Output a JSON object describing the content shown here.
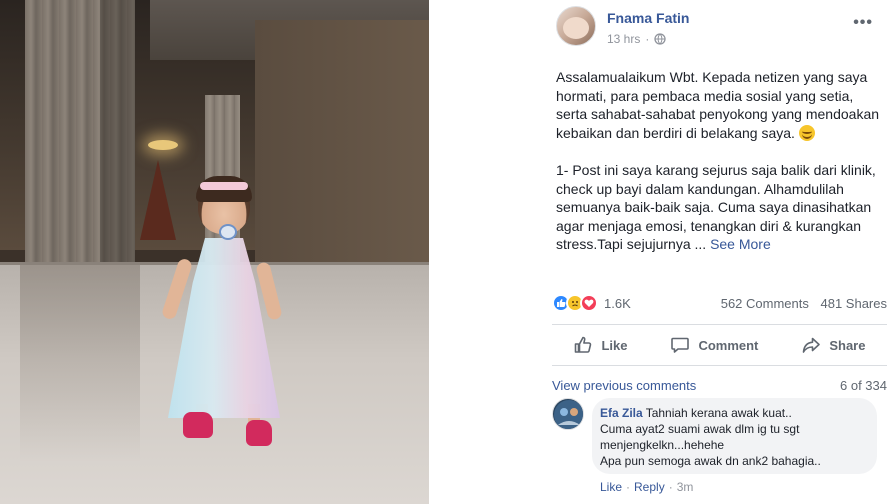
{
  "post": {
    "author": "Fnama Fatin",
    "time": "13 hrs",
    "privacy_icon": "globe-icon",
    "paragraph1": "Assalamualaikum Wbt. Kepada netizen yang saya hormati, para pembaca media sosial yang setia, serta sahabat-sahabat penyokong yang mendoakan kebaikan dan berdiri di belakang saya.",
    "paragraph2": "1- Post ini saya karang sejurus saja balik dari klinik, check up bayi dalam kandungan. Alhamdulilah semuanya baik-baik saja. Cuma saya dinasihatkan agar menjaga emosi, tenangkan diri & kurangkan stress.Tapi sejujurnya ...",
    "see_more": "See More",
    "more_icon": "•••"
  },
  "stats": {
    "reactions_count": "1.6K",
    "reaction_icons": [
      "like-reaction-icon",
      "sad-reaction-icon",
      "love-reaction-icon"
    ],
    "comments": "562 Comments",
    "shares": "481 Shares"
  },
  "actions": {
    "like": "Like",
    "comment": "Comment",
    "share": "Share"
  },
  "comments_section": {
    "view_previous": "View previous comments",
    "count": "6 of 334",
    "comment": {
      "author": "Efa Zila",
      "line1": "Tahniah kerana awak kuat..",
      "line2": "Cuma ayat2 suami awak dlm ig tu sgt",
      "line3": "menjengkelkn...hehehe",
      "line4": "Apa pun semoga awak dn ank2 bahagia..",
      "like": "Like",
      "reply": "Reply",
      "time": "3m",
      "separator": "·"
    }
  },
  "colors": {
    "link": "#385898",
    "meta": "#90949c",
    "divider": "#dadde1"
  }
}
